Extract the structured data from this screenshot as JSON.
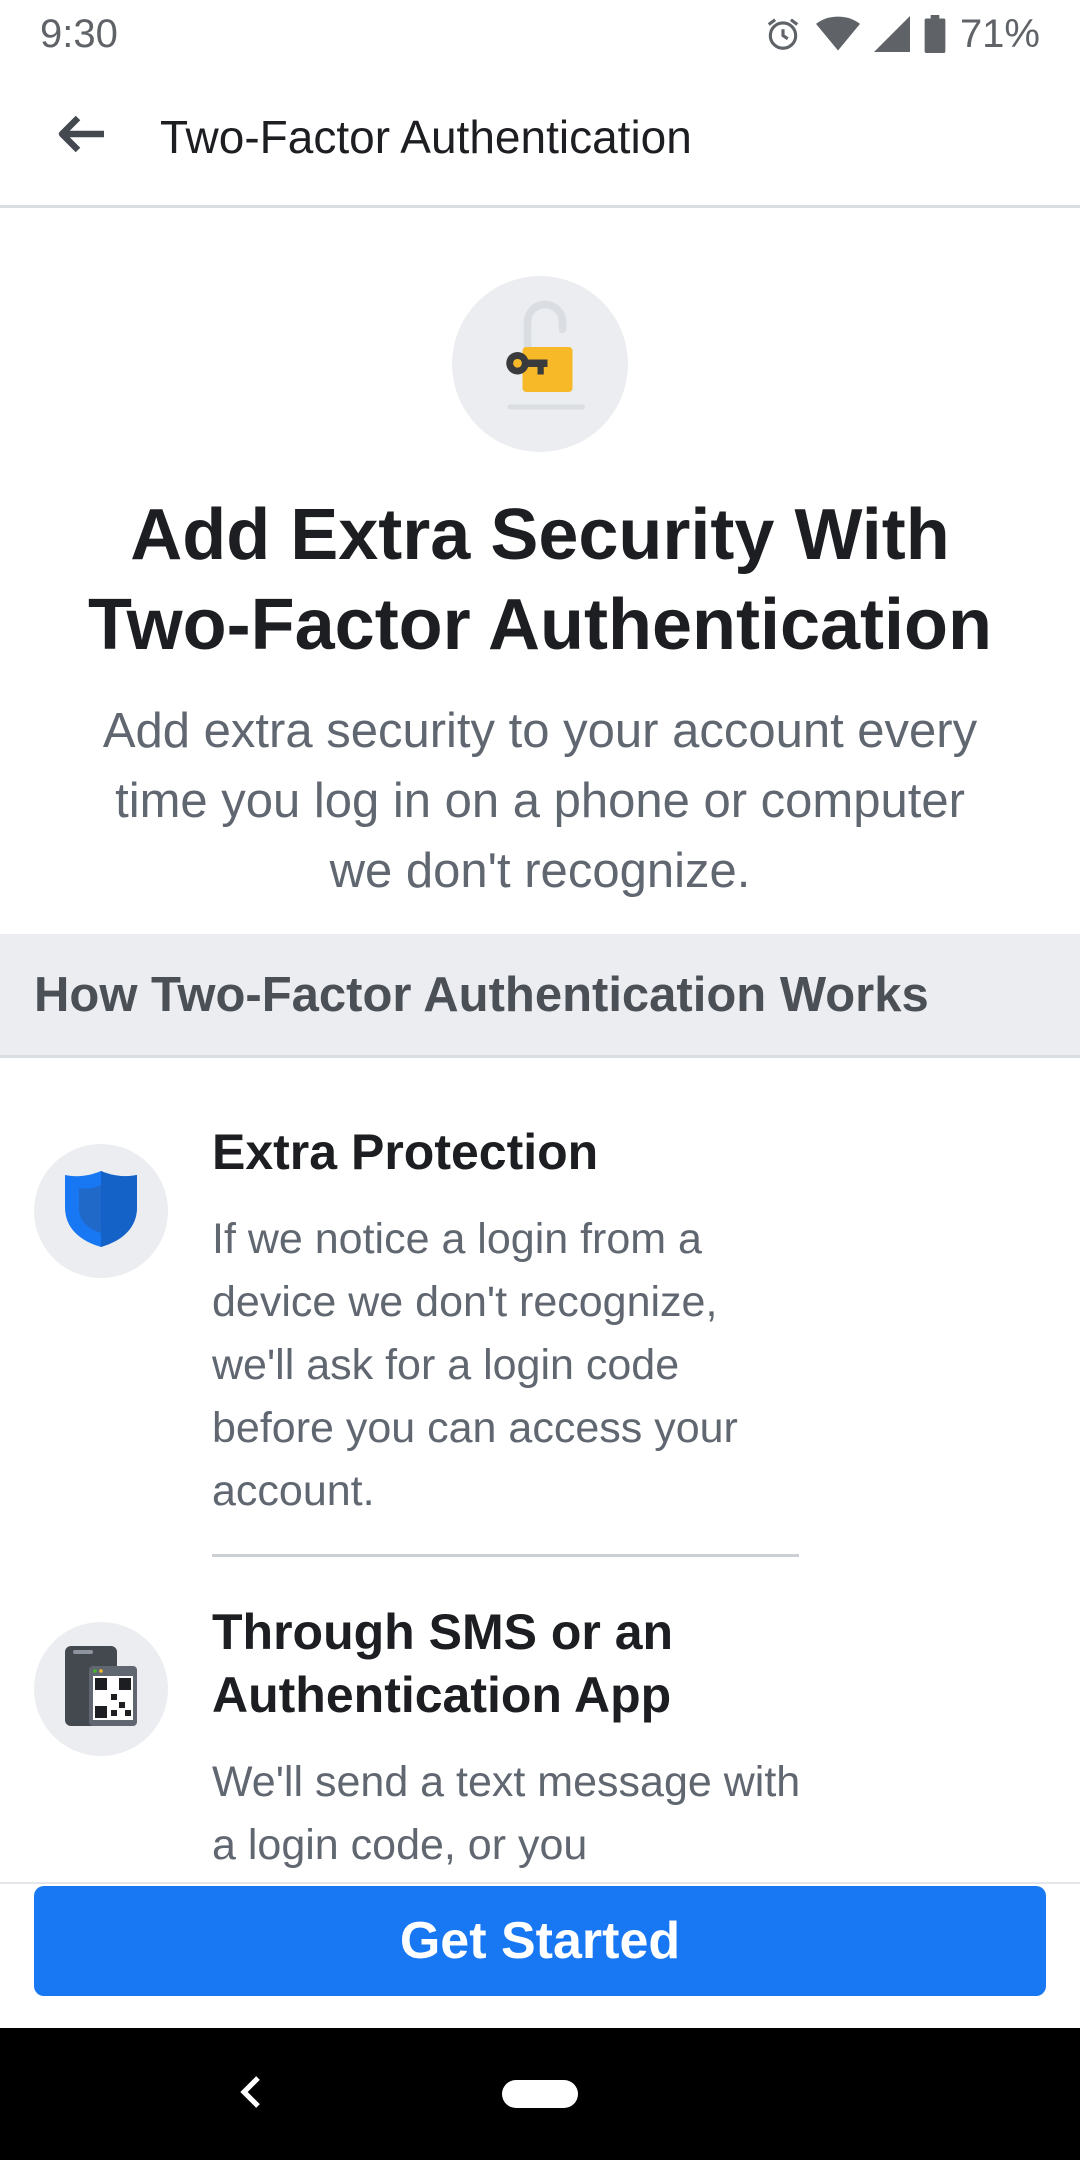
{
  "status_bar": {
    "time": "9:30",
    "battery": "71%",
    "icons": [
      "alarm-icon",
      "wifi-icon",
      "cell-signal-icon",
      "battery-icon"
    ]
  },
  "app_bar": {
    "back_icon": "arrow-left-icon",
    "title": "Two-Factor Authentication"
  },
  "hero": {
    "icon": "padlock-key-icon",
    "title": "Add Extra Security With Two-Factor Authentication",
    "subtitle": "Add extra security to your account every time you log in on a phone or computer we don't recognize."
  },
  "section": {
    "header": "How Two-Factor Authentication Works"
  },
  "features": [
    {
      "icon": "shield-icon",
      "title": "Extra Protection",
      "description": "If we notice a login from a device we don't recognize, we'll ask for a login code before you can access your account."
    },
    {
      "icon": "phone-qr-code-icon",
      "title": "Through SMS or an Authentication App",
      "description": "We'll send a text message with a login code, or you"
    }
  ],
  "cta": {
    "label": "Get Started"
  },
  "colors": {
    "primary": "#1877f2",
    "text_primary": "#1c1e21",
    "text_secondary": "#606770",
    "section_bg": "#ebedf0",
    "lock_yellow": "#f7b928",
    "shield_blue": "#1877f2"
  }
}
